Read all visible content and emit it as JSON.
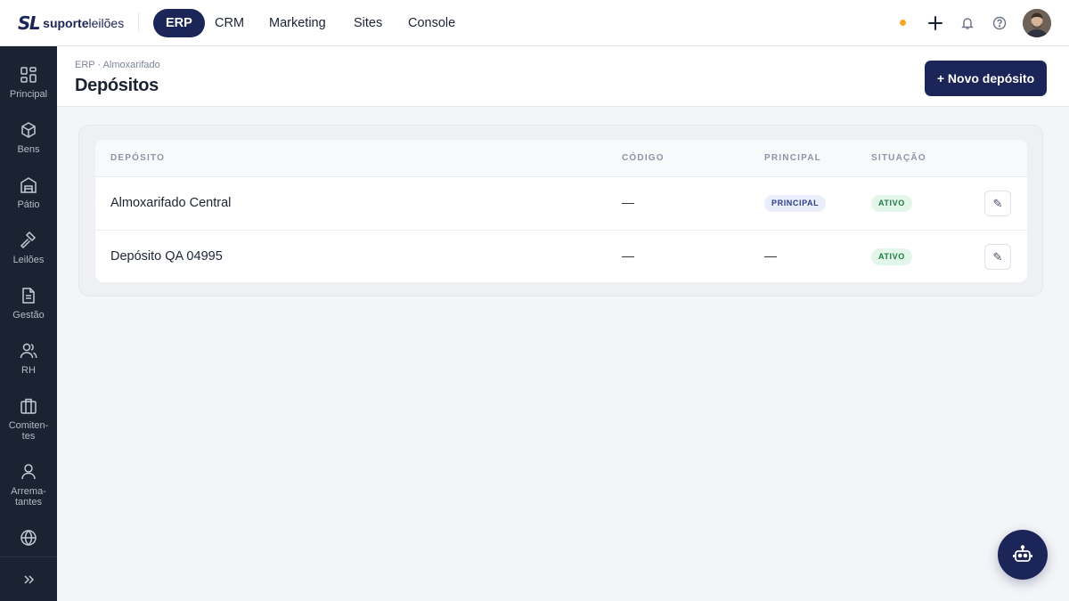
{
  "brand": {
    "mark": "SL",
    "name_bold": "suporte",
    "name_light": "leilões"
  },
  "topnav": {
    "tabs": [
      {
        "label": "ERP",
        "active": true
      },
      {
        "label": "CRM",
        "active": false
      },
      {
        "label": "Marketing",
        "active": false
      },
      {
        "label": "Sites",
        "active": false
      },
      {
        "label": "Console",
        "active": false
      }
    ],
    "icons": [
      "status-dot",
      "plus-icon",
      "bell-icon",
      "help-icon"
    ],
    "status_color": "#f5a623"
  },
  "sidebar": {
    "items": [
      {
        "label": "Principal",
        "icon": "grid-icon"
      },
      {
        "label": "Bens",
        "icon": "box-icon"
      },
      {
        "label": "Pátio",
        "icon": "warehouse-icon"
      },
      {
        "label": "Leilões",
        "icon": "gavel-icon"
      },
      {
        "label": "Gestão",
        "icon": "document-icon"
      },
      {
        "label": "RH",
        "icon": "users-icon"
      },
      {
        "label": "Comiten-\ntes",
        "icon": "briefcase-icon"
      },
      {
        "label": "Arrema-\ntantes",
        "icon": "user-icon"
      },
      {
        "label": "",
        "icon": "globe-icon"
      }
    ],
    "collapse_icon": "chevrons-right-icon"
  },
  "header": {
    "breadcrumb": "ERP · Almoxarifado",
    "title": "Depósitos",
    "new_button": "+ Novo depósito"
  },
  "table": {
    "columns": [
      "DEPÓSITO",
      "CÓDIGO",
      "PRINCIPAL",
      "SITUAÇÃO"
    ],
    "rows": [
      {
        "name": "Almoxarifado Central",
        "code": "—",
        "principal": "PRINCIPAL",
        "status": "ATIVO"
      },
      {
        "name": "Depósito QA 04995",
        "code": "—",
        "principal": "—",
        "status": "ATIVO"
      }
    ],
    "edit_icon": "✎"
  },
  "colors": {
    "brand": "#1b2558",
    "sidebar": "#1b2333",
    "active_badge": "#1f7a43"
  }
}
